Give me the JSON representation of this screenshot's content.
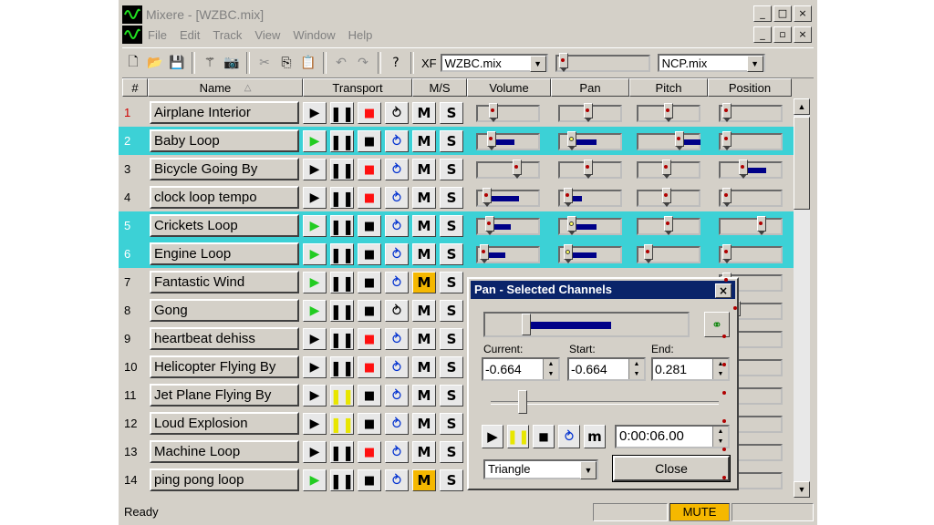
{
  "window": {
    "title": "Mixere - [WZBC.mix]",
    "caption_buttons": [
      "_",
      "□",
      "×"
    ],
    "child_caption_buttons": [
      "_",
      "▫",
      "×"
    ]
  },
  "menu": [
    "File",
    "Edit",
    "Track",
    "View",
    "Window",
    "Help"
  ],
  "toolbar": {
    "xf_label": "XF",
    "mix_file": "WZBC.mix",
    "ncp_file": "NCP.mix"
  },
  "headers": {
    "num": "#",
    "name": "Name",
    "sort_icon": "△",
    "transport": "Transport",
    "ms": "M/S",
    "volume": "Volume",
    "pan": "Pan",
    "pitch": "Pitch",
    "position": "Position"
  },
  "tracks": [
    {
      "num": "1",
      "name": "Airplane Interior",
      "selected": false,
      "num_red": true,
      "play_green": false,
      "pause_yellow": false,
      "stop_red": true,
      "loop_blue": false,
      "mute_on": false,
      "mute": "M",
      "solo": "S"
    },
    {
      "num": "2",
      "name": "Baby Loop",
      "selected": true,
      "num_red": false,
      "play_green": true,
      "pause_yellow": false,
      "stop_red": false,
      "loop_blue": true,
      "mute_on": false,
      "mute": "M",
      "solo": "S"
    },
    {
      "num": "3",
      "name": "Bicycle Going By",
      "selected": false,
      "num_red": false,
      "play_green": false,
      "pause_yellow": false,
      "stop_red": true,
      "loop_blue": true,
      "mute_on": false,
      "mute": "M",
      "solo": "S"
    },
    {
      "num": "4",
      "name": "clock loop tempo",
      "selected": false,
      "num_red": false,
      "play_green": false,
      "pause_yellow": false,
      "stop_red": true,
      "loop_blue": true,
      "mute_on": false,
      "mute": "M",
      "solo": "S"
    },
    {
      "num": "5",
      "name": "Crickets Loop",
      "selected": true,
      "num_red": false,
      "play_green": true,
      "pause_yellow": false,
      "stop_red": false,
      "loop_blue": true,
      "mute_on": false,
      "mute": "M",
      "solo": "S"
    },
    {
      "num": "6",
      "name": "Engine Loop",
      "selected": true,
      "num_red": false,
      "play_green": true,
      "pause_yellow": false,
      "stop_red": false,
      "loop_blue": true,
      "mute_on": false,
      "mute": "M",
      "solo": "S"
    },
    {
      "num": "7",
      "name": "Fantastic Wind",
      "selected": false,
      "num_red": false,
      "play_green": true,
      "pause_yellow": false,
      "stop_red": false,
      "loop_blue": true,
      "mute_on": true,
      "mute": "M",
      "solo": "S"
    },
    {
      "num": "8",
      "name": "Gong",
      "selected": false,
      "num_red": false,
      "play_green": true,
      "pause_yellow": false,
      "stop_red": false,
      "loop_blue": false,
      "mute_on": false,
      "mute": "M",
      "solo": "S"
    },
    {
      "num": "9",
      "name": "heartbeat dehiss",
      "selected": false,
      "num_red": false,
      "play_green": false,
      "pause_yellow": false,
      "stop_red": true,
      "loop_blue": true,
      "mute_on": false,
      "mute": "M",
      "solo": "S"
    },
    {
      "num": "10",
      "name": "Helicopter Flying By",
      "selected": false,
      "num_red": false,
      "play_green": false,
      "pause_yellow": false,
      "stop_red": true,
      "loop_blue": true,
      "mute_on": false,
      "mute": "M",
      "solo": "S"
    },
    {
      "num": "11",
      "name": "Jet Plane Flying By",
      "selected": false,
      "num_red": false,
      "play_green": false,
      "pause_yellow": true,
      "stop_red": false,
      "loop_blue": true,
      "mute_on": false,
      "mute": "M",
      "solo": "S"
    },
    {
      "num": "12",
      "name": "Loud Explosion",
      "selected": false,
      "num_red": false,
      "play_green": false,
      "pause_yellow": true,
      "stop_red": false,
      "loop_blue": true,
      "mute_on": false,
      "mute": "M",
      "solo": "S"
    },
    {
      "num": "13",
      "name": "Machine Loop",
      "selected": false,
      "num_red": false,
      "play_green": false,
      "pause_yellow": false,
      "stop_red": true,
      "loop_blue": true,
      "mute_on": false,
      "mute": "M",
      "solo": "S"
    },
    {
      "num": "14",
      "name": "ping pong loop",
      "selected": false,
      "num_red": false,
      "play_green": true,
      "pause_yellow": false,
      "stop_red": false,
      "loop_blue": true,
      "mute_on": true,
      "mute": "M",
      "solo": "S"
    }
  ],
  "dialog": {
    "title": "Pan - Selected Channels",
    "close_x": "×",
    "current_label": "Current:",
    "start_label": "Start:",
    "end_label": "End:",
    "current": "-0.664",
    "start": "-0.664",
    "end": "0.281",
    "m_label": "m",
    "time": "0:00:06.00",
    "waveform": "Triangle",
    "close_label": "Close"
  },
  "status": {
    "text": "Ready",
    "mute": "MUTE"
  },
  "colors": {
    "selected_row": "#3cd1d6",
    "mute_on": "#f5b800",
    "dialog_title": "#0a246a",
    "fill": "#000088"
  }
}
